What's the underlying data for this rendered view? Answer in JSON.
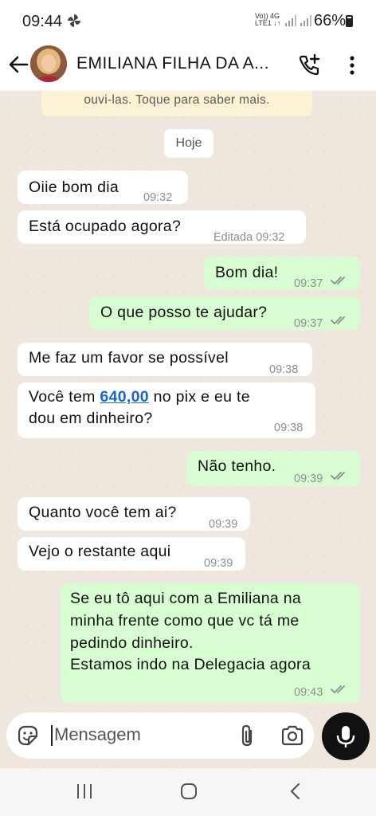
{
  "status_bar": {
    "time": "09:44",
    "network_line1": "Vo)) 4G",
    "network_line2": "LTE1 ↓↑",
    "battery": "66%"
  },
  "header": {
    "contact_name": "EMILIANA FILHA DA A..."
  },
  "notice": {
    "text": "ouvi-las. Toque para saber mais."
  },
  "date_chip": "Hoje",
  "messages": [
    {
      "dir": "in",
      "text": "Oiie bom dia",
      "time": "09:32"
    },
    {
      "dir": "in",
      "text": "Está ocupado agora?",
      "time": "Editada 09:32"
    },
    {
      "dir": "out",
      "text": "Bom dia!",
      "time": "09:37",
      "read": true
    },
    {
      "dir": "out",
      "text": "O que posso te ajudar?",
      "time": "09:37",
      "read": true
    },
    {
      "dir": "in",
      "text": "Me faz um favor se possível",
      "time": "09:38"
    },
    {
      "dir": "in",
      "text_before": "Você tem ",
      "link": "640,00",
      "text_after": " no pix e eu te",
      "text_line2": "dou em dinheiro?",
      "time": "09:38"
    },
    {
      "dir": "out",
      "text": "Não tenho.",
      "time": "09:39",
      "read": true
    },
    {
      "dir": "in",
      "text": "Quanto você tem ai?",
      "time": "09:39"
    },
    {
      "dir": "in",
      "text": "Vejo o restante aqui",
      "time": "09:39"
    },
    {
      "dir": "out",
      "lines": [
        "Se eu tô aqui com a Emiliana na",
        "minha frente como que vc tá me",
        "pedindo dinheiro.",
        "Estamos indo na Delegacia agora"
      ],
      "time": "09:43",
      "read": true
    }
  ],
  "input": {
    "placeholder": "Mensagem"
  },
  "colors": {
    "incoming": "#ffffff",
    "outgoing": "#d9fdd3",
    "read_ticks": "#8a8f90",
    "link": "#1a66c8",
    "background": "#efe7de"
  },
  "icons": [
    "back-arrow-icon",
    "avatar",
    "add-call-icon",
    "more-vert-icon",
    "emoji-sticker-icon",
    "attach-clip-icon",
    "camera-icon",
    "mic-icon",
    "nav-recents-icon",
    "nav-home-icon",
    "nav-back-icon"
  ]
}
